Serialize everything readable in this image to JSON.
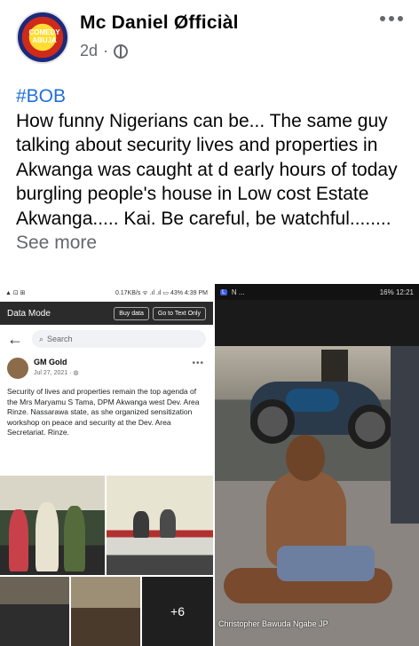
{
  "post": {
    "author": "Mc Daniel Øfficiàl",
    "time": "2d",
    "separator": "·",
    "hashtag": "#BOB",
    "body": "How funny Nigerians can be... The same guy talking about security lives and properties in Akwanga was caught at d early hours of today burgling people's house in Low cost Estate Akwanga..... Kai. Be careful, be watchful........",
    "see_more": "See more",
    "avatar_text": "COMEDY ABUJA"
  },
  "left_image": {
    "status_bar": {
      "left": "▲ ⊡ ⊞",
      "right": "0.17KB/s ᯤ .ıl .ıl ▭ 43% 4:39 PM"
    },
    "data_mode": "Data Mode",
    "buy_data": "Buy data",
    "go_text": "Go to Text Only",
    "search_placeholder": "Search",
    "inner_author": "GM Gold",
    "inner_date": "Jul 27, 2021 · ",
    "inner_text": "Security of lives and properties remain the top agenda of the Mrs Maryamu S Tama, DPM Akwanga west Dev. Area Rinze. Nassarawa state, as she organized sensitization workshop on peace and security at the Dev. Area Secretariat. Rinze.",
    "more_photos": "+6"
  },
  "right_image": {
    "status_bar": {
      "left": "N ...",
      "right": "16% 12:21"
    },
    "caption": "Christopher Bawuda Ngabe JP"
  },
  "colors": {
    "hashtag": "#216fdb",
    "meta": "#65676b",
    "text": "#050505"
  }
}
